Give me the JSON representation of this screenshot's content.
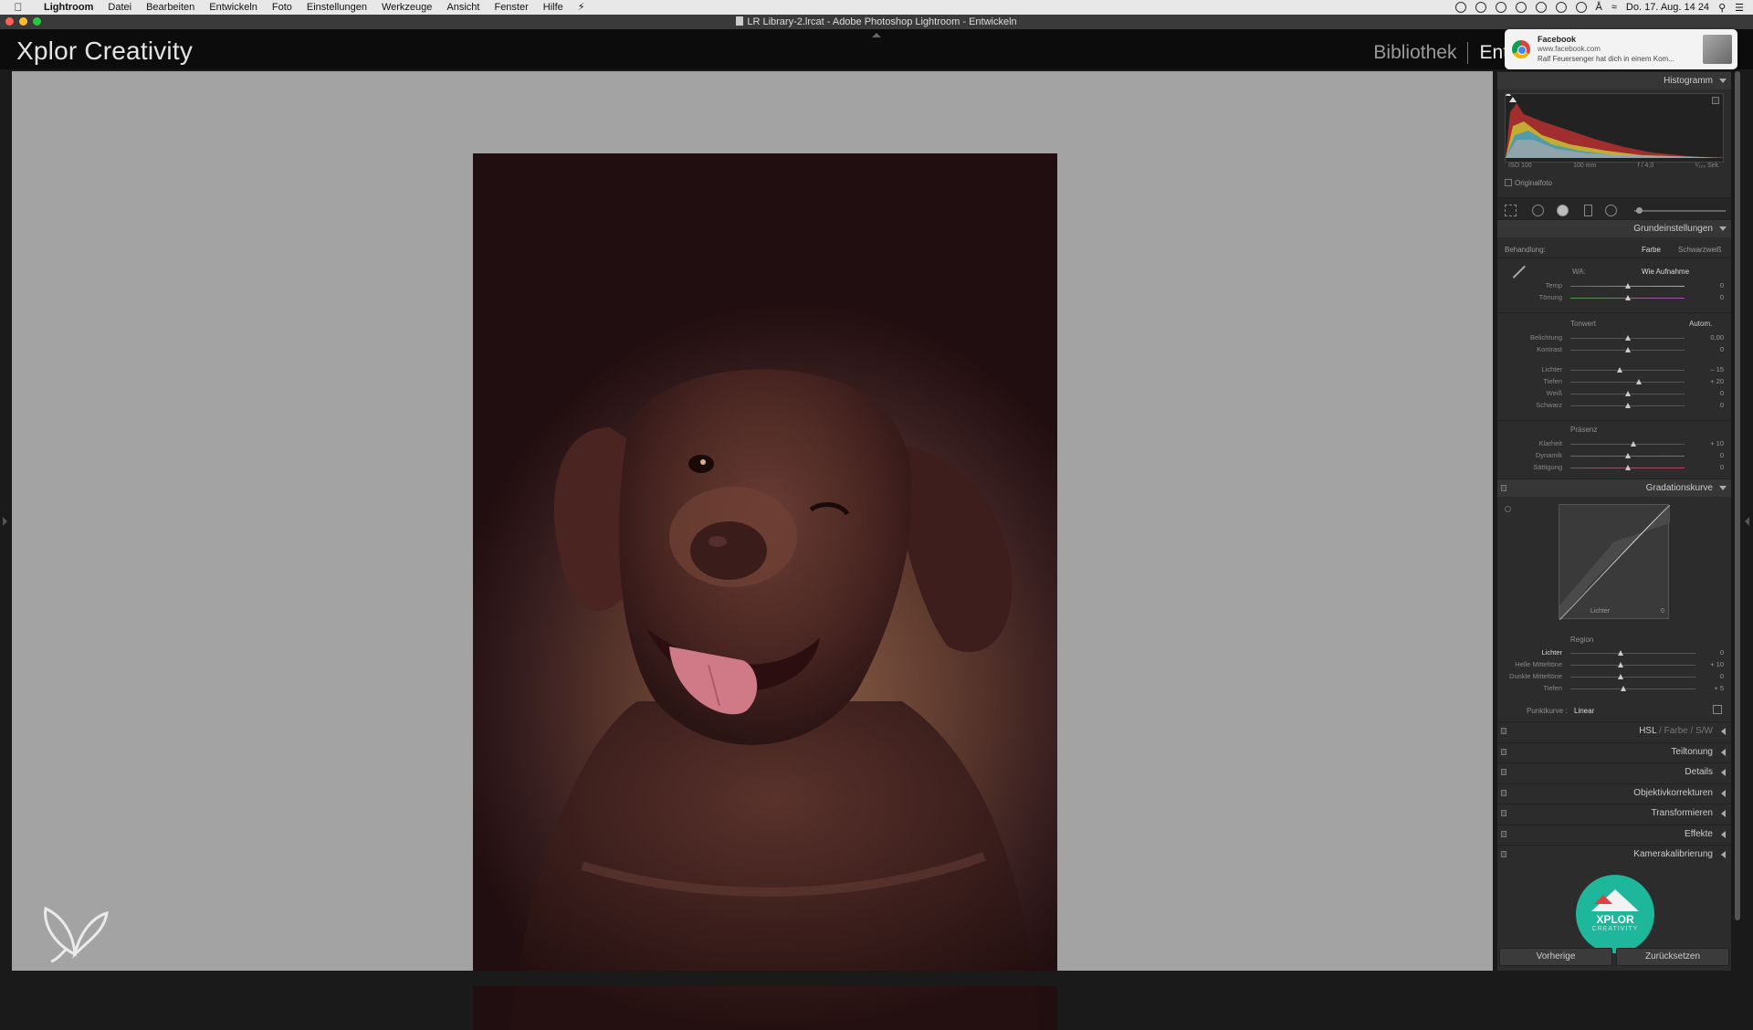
{
  "menubar": {
    "items": [
      "Lightroom",
      "Datei",
      "Bearbeiten",
      "Entwickeln",
      "Foto",
      "Einstellungen",
      "Werkzeuge",
      "Ansicht",
      "Fenster",
      "Hilfe"
    ],
    "clock": "Do. 17. Aug. 14 24"
  },
  "window": {
    "title": "LR Library-2.lrcat - Adobe Photoshop Lightroom - Entwickeln"
  },
  "header": {
    "brand": "Xplor Creativity",
    "module_library": "Bibliothek",
    "module_develop": "Ent"
  },
  "notification": {
    "title": "Facebook",
    "source": "www.facebook.com",
    "body": "Ralf Feuersenger hat dich in einem Kom..."
  },
  "panel": {
    "histogram_title": "Histogramm",
    "histo_info": {
      "iso": "ISO 100",
      "focal": "100 mm",
      "aperture": "f / 4,0",
      "shutter": "¹⁄₁₂₅ Sek."
    },
    "original_photo": "Originalfoto",
    "basic": {
      "title": "Grundeinstellungen",
      "treatment_label": "Behandlung:",
      "treatment_color": "Farbe",
      "treatment_bw": "Schwarzweiß",
      "wb_label": "WA:",
      "wb_value": "Wie Aufnahme",
      "temp": {
        "label": "Temp",
        "value": "0",
        "pos": 0.5
      },
      "tint": {
        "label": "Tönung",
        "value": "0",
        "pos": 0.5
      },
      "tone_label": "Tonwert",
      "auto_label": "Autom.",
      "exposure": {
        "label": "Belichtung",
        "value": "0,00",
        "pos": 0.5
      },
      "contrast": {
        "label": "Kontrast",
        "value": "0",
        "pos": 0.5
      },
      "highlights": {
        "label": "Lichter",
        "value": "– 15",
        "pos": 0.43
      },
      "shadows": {
        "label": "Tiefen",
        "value": "+ 20",
        "pos": 0.6
      },
      "whites": {
        "label": "Weiß",
        "value": "0",
        "pos": 0.5
      },
      "blacks": {
        "label": "Schwarz",
        "value": "0",
        "pos": 0.5
      },
      "presence_label": "Präsenz",
      "clarity": {
        "label": "Klarheit",
        "value": "+ 10",
        "pos": 0.55
      },
      "vibrance": {
        "label": "Dynamik",
        "value": "0",
        "pos": 0.5
      },
      "saturation": {
        "label": "Sättigung",
        "value": "0",
        "pos": 0.5
      }
    },
    "tonecurve": {
      "title": "Gradationskurve",
      "curve_label": "Lichter",
      "curve_value": "0",
      "region_label": "Region",
      "highlights": {
        "label": "Lichter",
        "value": "0",
        "pos": 0.4
      },
      "lights": {
        "label": "Helle Mitteltöne",
        "value": "+ 10",
        "pos": 0.4
      },
      "darks": {
        "label": "Dunkle Mitteltöne",
        "value": "0",
        "pos": 0.4
      },
      "shadows": {
        "label": "Tiefen",
        "value": "+ 5",
        "pos": 0.42
      },
      "pointcurve_label": "Punktkurve :",
      "pointcurve_value": "Linear"
    },
    "hsl": {
      "hsl": "HSL",
      "slash": "/",
      "color": "Farbe",
      "bw": "S/W"
    },
    "collapsed": [
      "Teiltonung",
      "Details",
      "Objektivkorrekturen",
      "Transformieren",
      "Effekte",
      "Kamerakalibrierung"
    ],
    "logo_text": "XPLOR",
    "logo_sub": "CREATIVITY",
    "btn_previous": "Vorherige",
    "btn_reset": "Zurücksetzen"
  }
}
